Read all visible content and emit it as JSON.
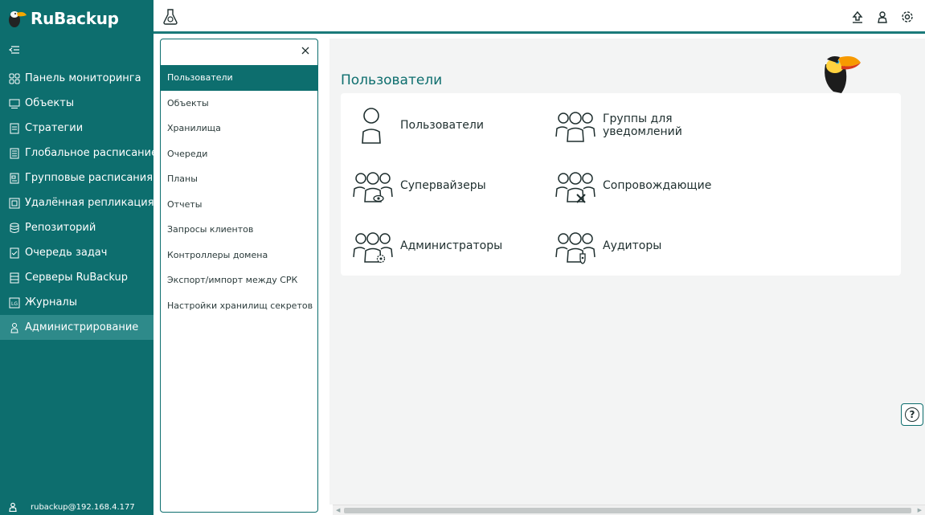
{
  "brand": {
    "name": "RuBackup"
  },
  "sidebar": {
    "items": [
      {
        "label": "Панель мониторинга",
        "icon": "dashboard-icon",
        "active": false
      },
      {
        "label": "Объекты",
        "icon": "monitor-icon",
        "active": false
      },
      {
        "label": "Стратегии",
        "icon": "document-icon",
        "active": false
      },
      {
        "label": "Глобальное расписание",
        "icon": "list-icon",
        "active": false
      },
      {
        "label": "Групповые расписания",
        "icon": "group-schedule-icon",
        "active": false
      },
      {
        "label": "Удалённая репликация",
        "icon": "replication-icon",
        "active": false
      },
      {
        "label": "Репозиторий",
        "icon": "database-icon",
        "active": false
      },
      {
        "label": "Очередь задач",
        "icon": "task-queue-icon",
        "active": false
      },
      {
        "label": "Серверы RuBackup",
        "icon": "server-icon",
        "active": false
      },
      {
        "label": "Журналы",
        "icon": "log-icon",
        "active": false
      },
      {
        "label": "Администрирование",
        "icon": "admin-users-icon",
        "active": true
      }
    ],
    "user": "rubackup@192.168.4.177"
  },
  "submenu": {
    "items": [
      {
        "label": "Пользователи",
        "active": true
      },
      {
        "label": "Объекты",
        "active": false
      },
      {
        "label": "Хранилища",
        "active": false
      },
      {
        "label": "Очереди",
        "active": false
      },
      {
        "label": "Планы",
        "active": false
      },
      {
        "label": "Отчеты",
        "active": false
      },
      {
        "label": "Запросы клиентов",
        "active": false
      },
      {
        "label": "Контроллеры домена",
        "active": false
      },
      {
        "label": "Экспорт/импорт между СРК",
        "active": false
      },
      {
        "label": "Настройки хранилищ секретов",
        "active": false
      }
    ]
  },
  "main": {
    "title": "Пользователи",
    "tiles": {
      "users": "Пользователи",
      "notify_groups_line1": "Группы для",
      "notify_groups_line2": "уведомлений",
      "supervisors": "Супервайзеры",
      "maintainers": "Сопровождающие",
      "administrators": "Администраторы",
      "auditors": "Аудиторы"
    }
  },
  "colors": {
    "brand": "#0d6e6e",
    "active_nav": "#2e8a8a",
    "accent": "#0d6e6e"
  },
  "help": {
    "label": "?"
  }
}
